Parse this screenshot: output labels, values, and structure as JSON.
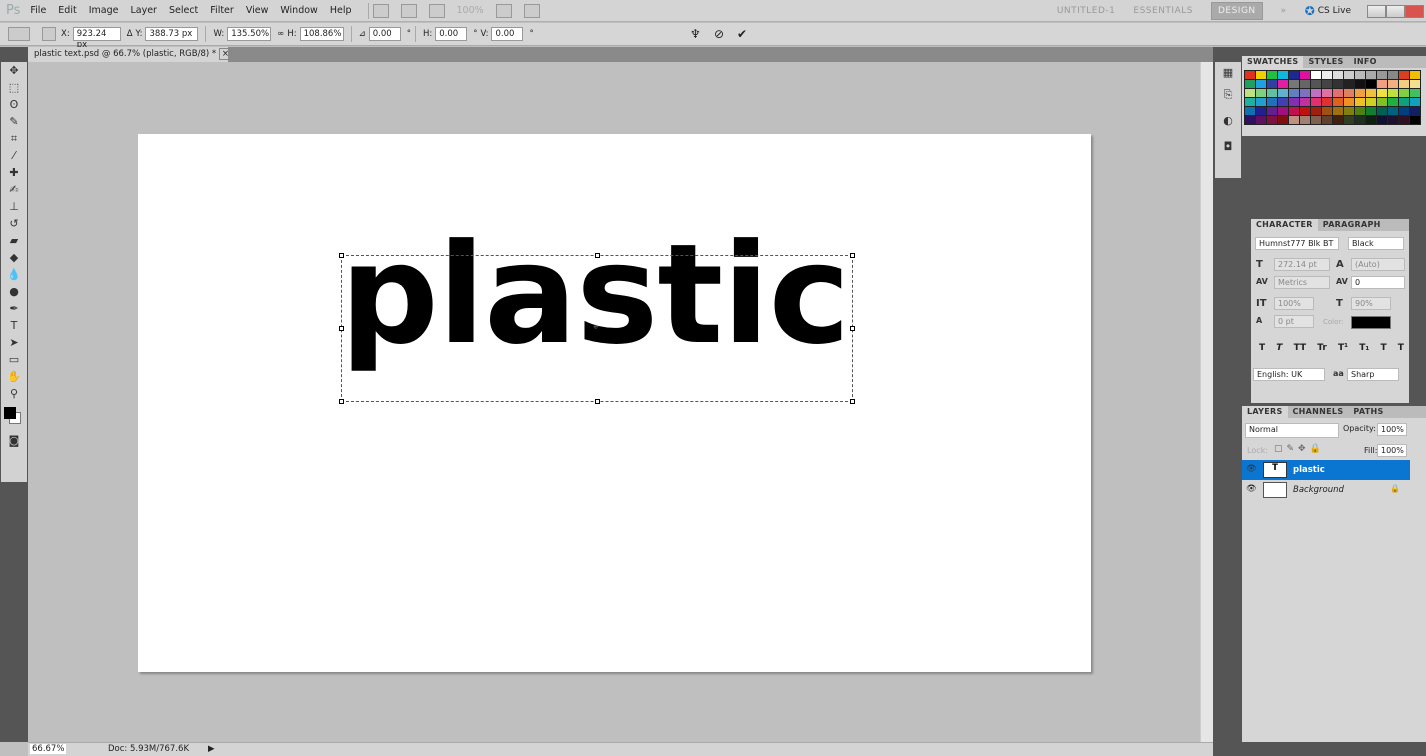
{
  "menubar": {
    "logo": "Ps",
    "items": [
      "File",
      "Edit",
      "Image",
      "Layer",
      "Select",
      "Filter",
      "View",
      "Window",
      "Help"
    ],
    "zoom": "100%",
    "workspaces": [
      "UNTITLED-1",
      "ESSENTIALS",
      "DESIGN"
    ],
    "active_workspace": "DESIGN",
    "cs_live": "CS Live"
  },
  "options": {
    "x_label": "X:",
    "x": "923.24 px",
    "y_label": "Y:",
    "y": "388.73 px",
    "w_label": "W:",
    "w": "135.50%",
    "h_label": "H:",
    "h": "108.86%",
    "angle": "0.00",
    "hskew_label": "H:",
    "hskew": "0.00",
    "vskew_label": "V:",
    "vskew": "0.00",
    "deg": "°"
  },
  "document": {
    "tab": "plastic text.psd @ 66.7% (plastic, RGB/8) *",
    "text": "plastic"
  },
  "swatches": {
    "tabs": [
      "SWATCHES",
      "STYLES",
      "INFO"
    ],
    "colors": [
      "#e0301e",
      "#f0d000",
      "#20c040",
      "#10b8e0",
      "#1a2a90",
      "#e010a0",
      "#ffffff",
      "#eeeeee",
      "#dddddd",
      "#cccccc",
      "#bbbbbb",
      "#aaaaaa",
      "#999999",
      "#888888",
      "#d84020",
      "#f0c000",
      "#20a060",
      "#20a0e0",
      "#3040a0",
      "#e020a0",
      "#777777",
      "#666666",
      "#555555",
      "#444444",
      "#333333",
      "#222222",
      "#111111",
      "#000000",
      "#f0a080",
      "#f0b080",
      "#f0d080",
      "#f0e090",
      "#c0e080",
      "#80d080",
      "#60c0a0",
      "#60b0d0",
      "#6080c0",
      "#8070c0",
      "#c070c0",
      "#e070a0",
      "#e07070",
      "#e08060",
      "#f0a040",
      "#f0c040",
      "#f0e040",
      "#c0e040",
      "#80d040",
      "#40c060",
      "#20b0a0",
      "#20a0d0",
      "#2070c0",
      "#4040b0",
      "#8030b0",
      "#c030a0",
      "#e03070",
      "#e03030",
      "#e06020",
      "#f09020",
      "#f0c020",
      "#d0d020",
      "#80c020",
      "#20b040",
      "#10a080",
      "#10a0c0",
      "#1070b0",
      "#202090",
      "#602090",
      "#a01080",
      "#c01050",
      "#c01010",
      "#a02010",
      "#a05010",
      "#a07010",
      "#808010",
      "#508010",
      "#108030",
      "#006050",
      "#006080",
      "#004080",
      "#102060",
      "#301060",
      "#601060",
      "#801040",
      "#801010",
      "#c09080",
      "#a08070",
      "#806050",
      "#604030",
      "#402010",
      "#304020",
      "#203020",
      "#102010",
      "#101030",
      "#201030",
      "#301020",
      "#000000"
    ]
  },
  "character": {
    "tabs": [
      "CHARACTER",
      "PARAGRAPH"
    ],
    "font_family": "Humnst777 Blk BT",
    "font_style": "Black",
    "size": "272.14 pt",
    "leading": "(Auto)",
    "kerning": "Metrics",
    "tracking": "0",
    "vscale": "100%",
    "hscale": "90%",
    "baseline": "0 pt",
    "color_label": "Color:",
    "text_color": "#000000",
    "language": "English: UK",
    "aa_label": "aa",
    "antialias": "Sharp",
    "style_buttons": [
      "T",
      "T",
      "TT",
      "Tr",
      "T¹",
      "T₁",
      "T",
      "T"
    ]
  },
  "layers": {
    "tabs": [
      "LAYERS",
      "CHANNELS",
      "PATHS"
    ],
    "blend_mode": "Normal",
    "opacity_label": "Opacity:",
    "opacity": "100%",
    "lock_label": "Lock:",
    "fill_label": "Fill:",
    "fill": "100%",
    "items": [
      {
        "name": "plastic",
        "thumb": "T",
        "selected": true
      },
      {
        "name": "Background",
        "thumb": "",
        "locked": true
      }
    ]
  },
  "status": {
    "zoom": "66.67%",
    "doc": "Doc: 5.93M/767.6K"
  },
  "colors": {
    "selection": "#0a76d2",
    "canvas_bg": "#bfbfbf"
  }
}
